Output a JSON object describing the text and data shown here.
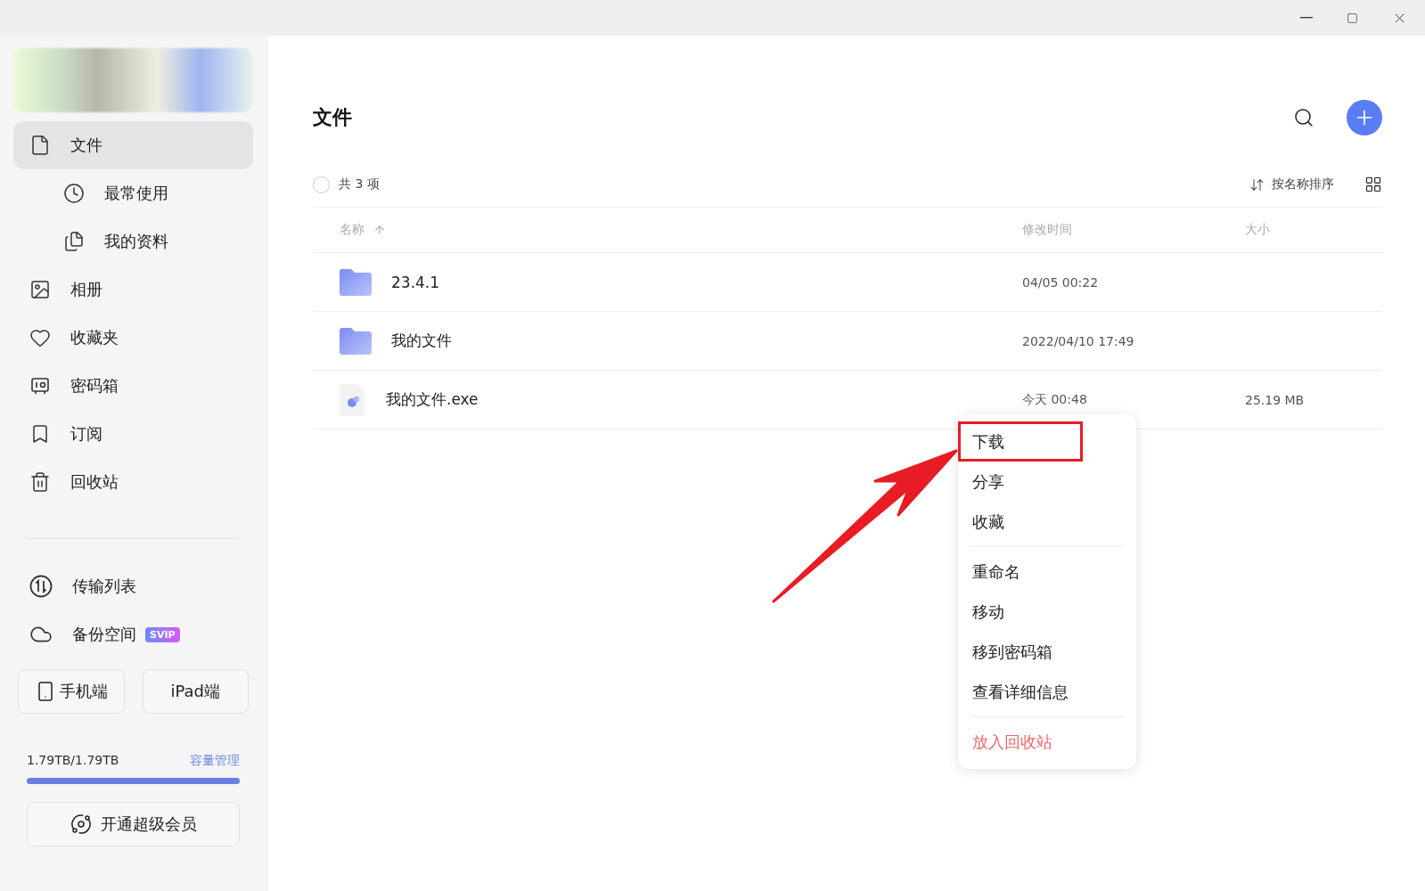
{
  "sidebar": {
    "nav": [
      {
        "label": "文件",
        "kind": "main",
        "selected": true
      },
      {
        "label": "最常使用",
        "kind": "sub",
        "selected": false
      },
      {
        "label": "我的资料",
        "kind": "sub",
        "selected": false
      },
      {
        "label": "相册",
        "kind": "main",
        "selected": false
      },
      {
        "label": "收藏夹",
        "kind": "main",
        "selected": false
      },
      {
        "label": "密码箱",
        "kind": "main",
        "selected": false
      },
      {
        "label": "订阅",
        "kind": "main",
        "selected": false
      },
      {
        "label": "回收站",
        "kind": "main",
        "selected": false
      }
    ],
    "tools": [
      {
        "label": "传输列表"
      },
      {
        "label": "备份空间",
        "badge": "SVIP"
      }
    ],
    "devices": [
      "手机端",
      "iPad端"
    ],
    "storage": {
      "used": "1.79TB/1.79TB",
      "manage": "容量管理",
      "level": 1
    },
    "vip_button": "开通超级会员"
  },
  "main": {
    "title": "文件",
    "all_checked": false,
    "count": "共 3 项",
    "sort": "按名称排序",
    "columns": [
      "名称",
      "修改时间",
      "大小"
    ],
    "rows": [
      {
        "kind": "folder",
        "name": "23.4.1",
        "modified": "04/05 00:22"
      },
      {
        "kind": "folder",
        "name": "我的文件",
        "modified": "2022/04/10 17:49"
      },
      {
        "kind": "file",
        "name": "我的文件.exe",
        "modified": "今天 00:48",
        "size": "25.19 MB"
      }
    ]
  },
  "context_menu": {
    "groups": [
      [
        {
          "label": "下载",
          "highlighted": true
        },
        {
          "label": "分享",
          "highlighted": false
        },
        {
          "label": "收藏",
          "highlighted": false
        }
      ],
      [
        {
          "label": "重命名",
          "highlighted": false
        },
        {
          "label": "移动",
          "highlighted": false
        },
        {
          "label": "移到密码箱",
          "highlighted": false
        },
        {
          "label": "查看详细信息",
          "highlighted": false
        }
      ],
      [
        {
          "label": "放入回收站",
          "highlighted": false,
          "kind": "danger"
        }
      ]
    ]
  }
}
